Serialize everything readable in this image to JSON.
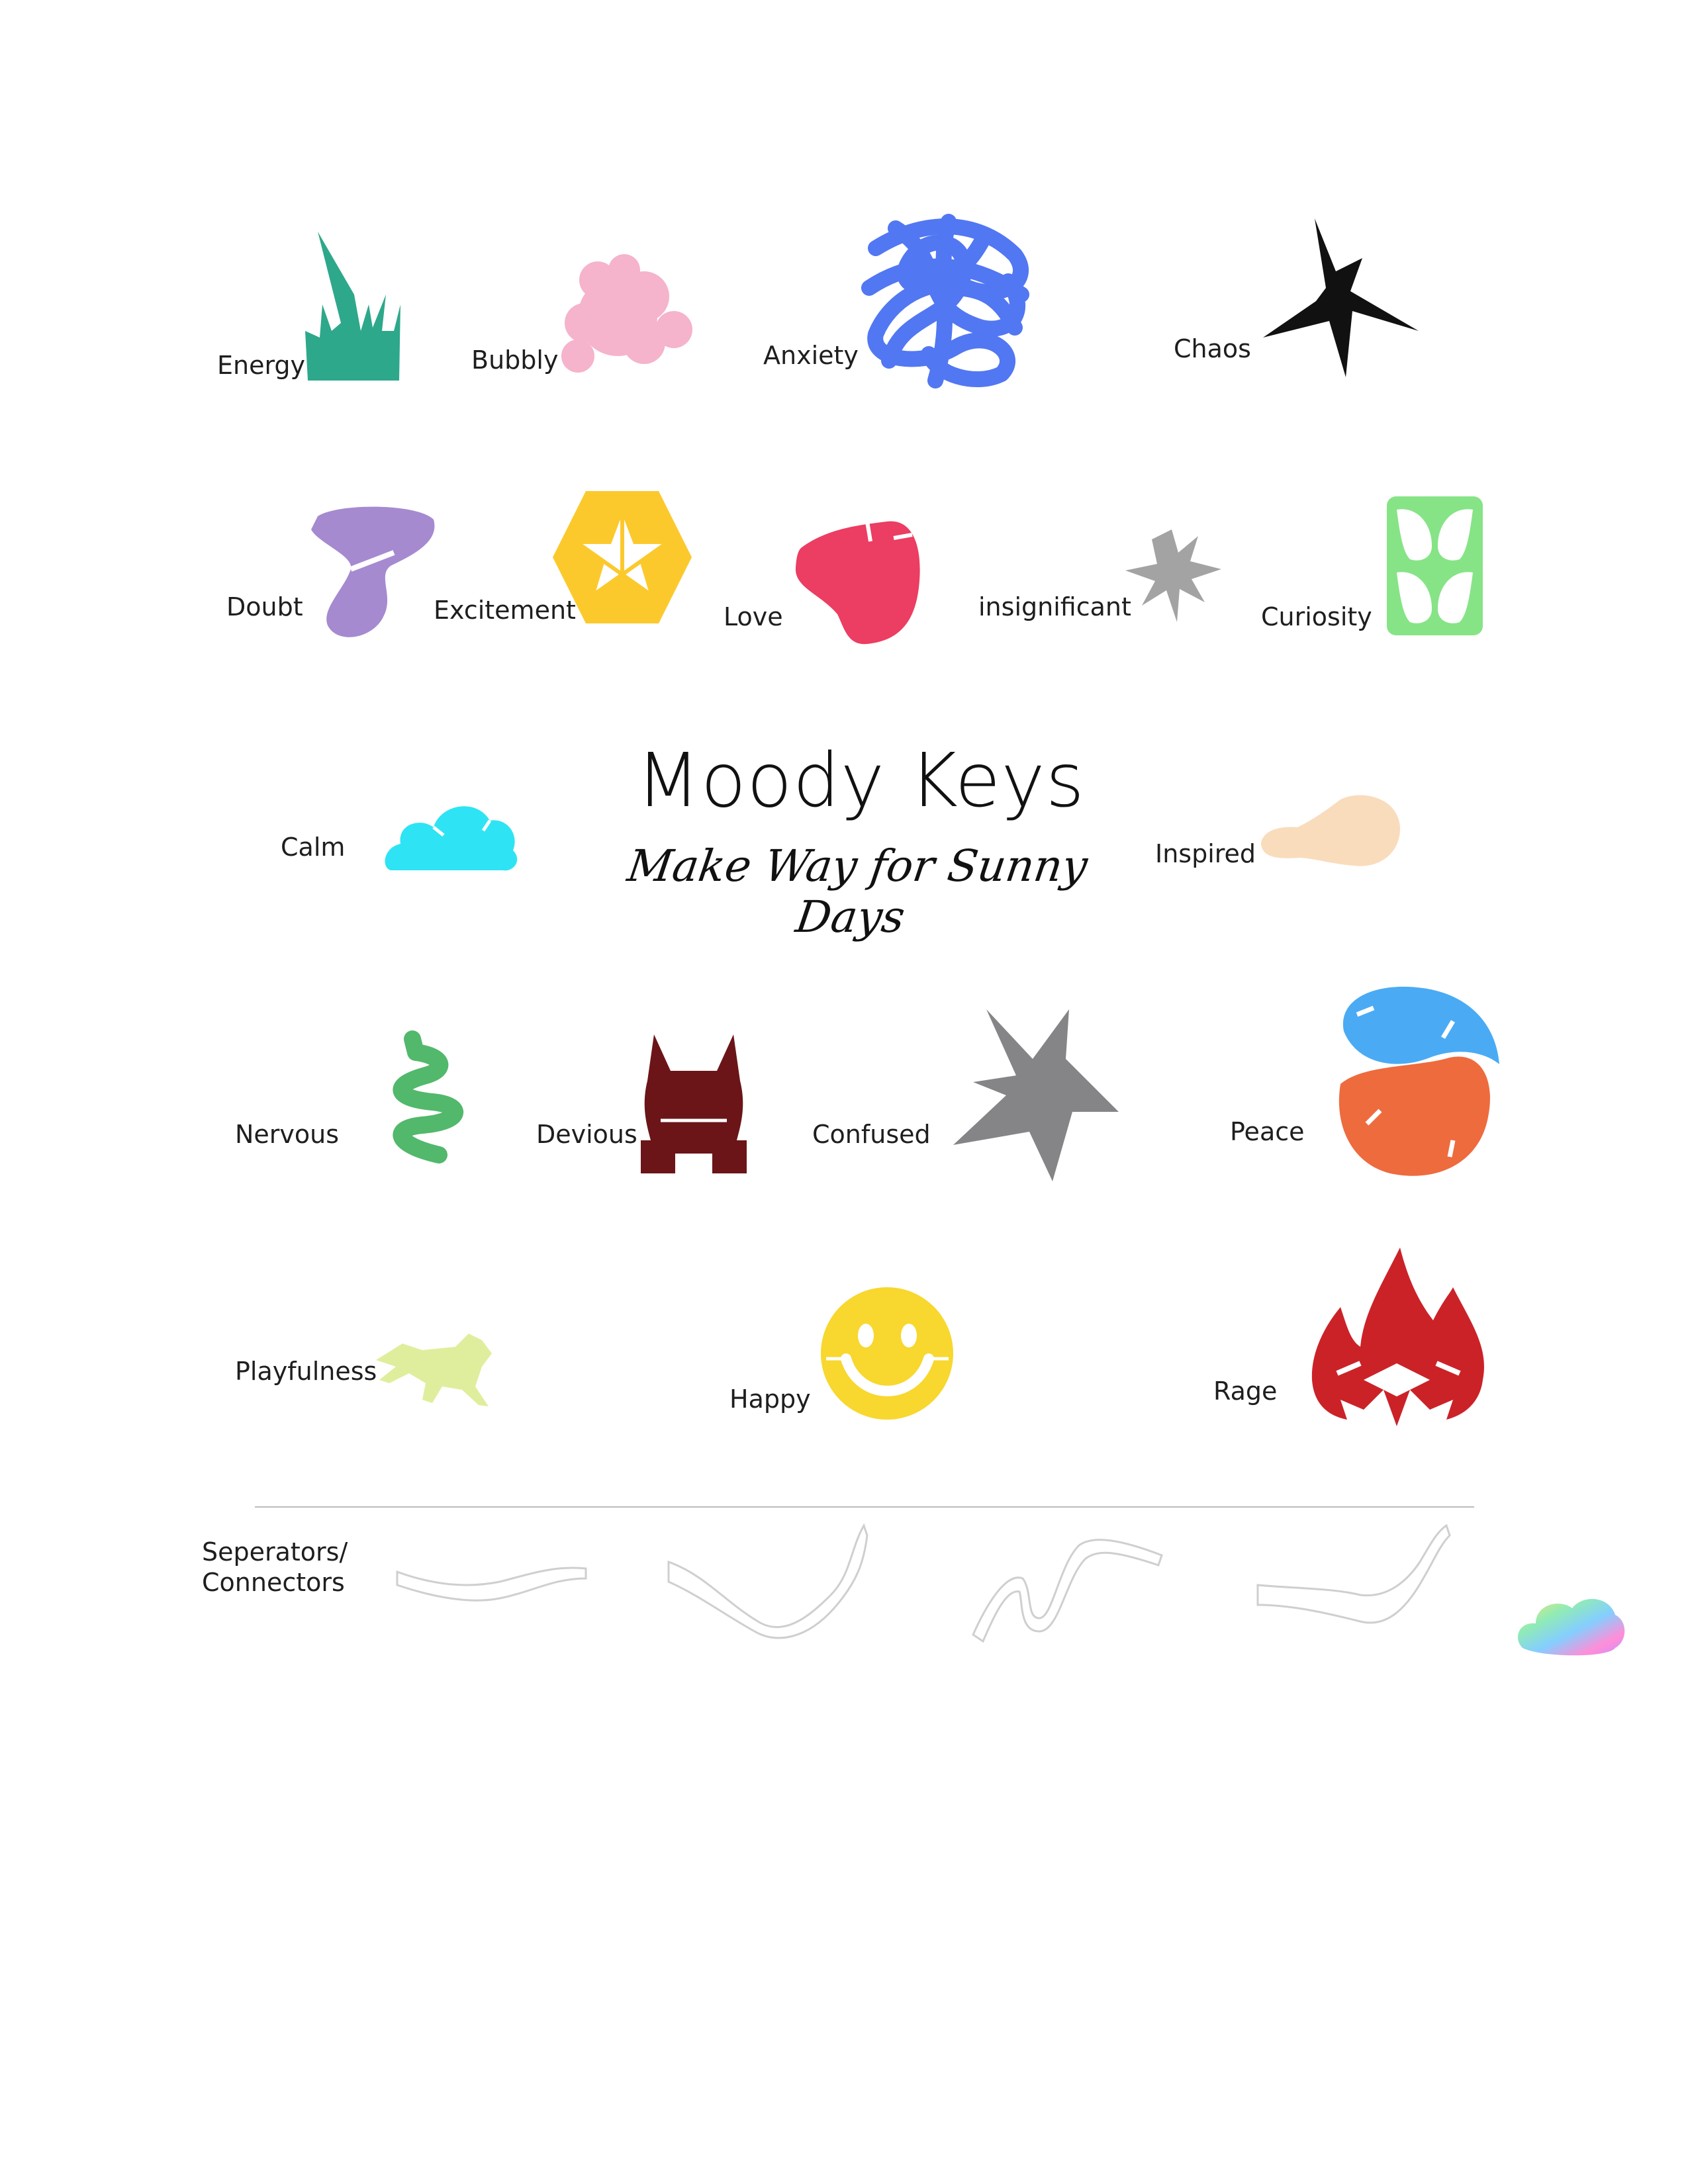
{
  "title": "Moody Keys",
  "subtitle": "Make Way for Sunny Days",
  "moods": {
    "energy": {
      "label": "Energy",
      "color": "#2ea88a",
      "icon": "grass-icon"
    },
    "bubbly": {
      "label": "Bubbly",
      "color": "#f5b3cc",
      "icon": "bubbles-icon"
    },
    "anxiety": {
      "label": "Anxiety",
      "color": "#5277f2",
      "icon": "scribble-icon"
    },
    "chaos": {
      "label": "Chaos",
      "color": "#111111",
      "icon": "burst-star-icon"
    },
    "doubt": {
      "label": "Doubt",
      "color": "#a58ad0",
      "icon": "tornado-icon"
    },
    "excitement": {
      "label": "Excitement",
      "color": "#fcc92d",
      "icon": "hexagon-star-icon"
    },
    "love": {
      "label": "Love",
      "color": "#ec3d62",
      "icon": "heart-icon"
    },
    "insignificant": {
      "label": "insignificant",
      "color": "#a3a3a3",
      "icon": "small-star-icon"
    },
    "curiosity": {
      "label": "Curiosity",
      "color": "#86e486",
      "icon": "tile-icon"
    },
    "calm": {
      "label": "Calm",
      "color": "#2ee4f4",
      "icon": "cloud-icon"
    },
    "inspired": {
      "label": "Inspired",
      "color": "#f9dcbc",
      "icon": "lightbulb-icon"
    },
    "nervous": {
      "label": "Nervous",
      "color": "#52b86c",
      "icon": "squiggle-icon"
    },
    "devious": {
      "label": "Devious",
      "color": "#6b1519",
      "icon": "devil-icon"
    },
    "confused": {
      "label": "Confused",
      "color": "#858588",
      "icon": "shatter-icon"
    },
    "peace": {
      "label": "Peace",
      "color_top": "#4aabf4",
      "color_bottom": "#ee6b3e",
      "icon": "yin-yang-icon"
    },
    "playfulness": {
      "label": "Playfulness",
      "color": "#dfee9c",
      "icon": "leaping-animal-icon"
    },
    "happy": {
      "label": "Happy",
      "color": "#f8d72e",
      "icon": "smiley-icon"
    },
    "rage": {
      "label": "Rage",
      "color": "#cb2228",
      "icon": "flame-icon"
    }
  },
  "separators": {
    "label_line1": "Seperators/",
    "label_line2": "Connectors",
    "stroke": "#cfcfcf"
  }
}
